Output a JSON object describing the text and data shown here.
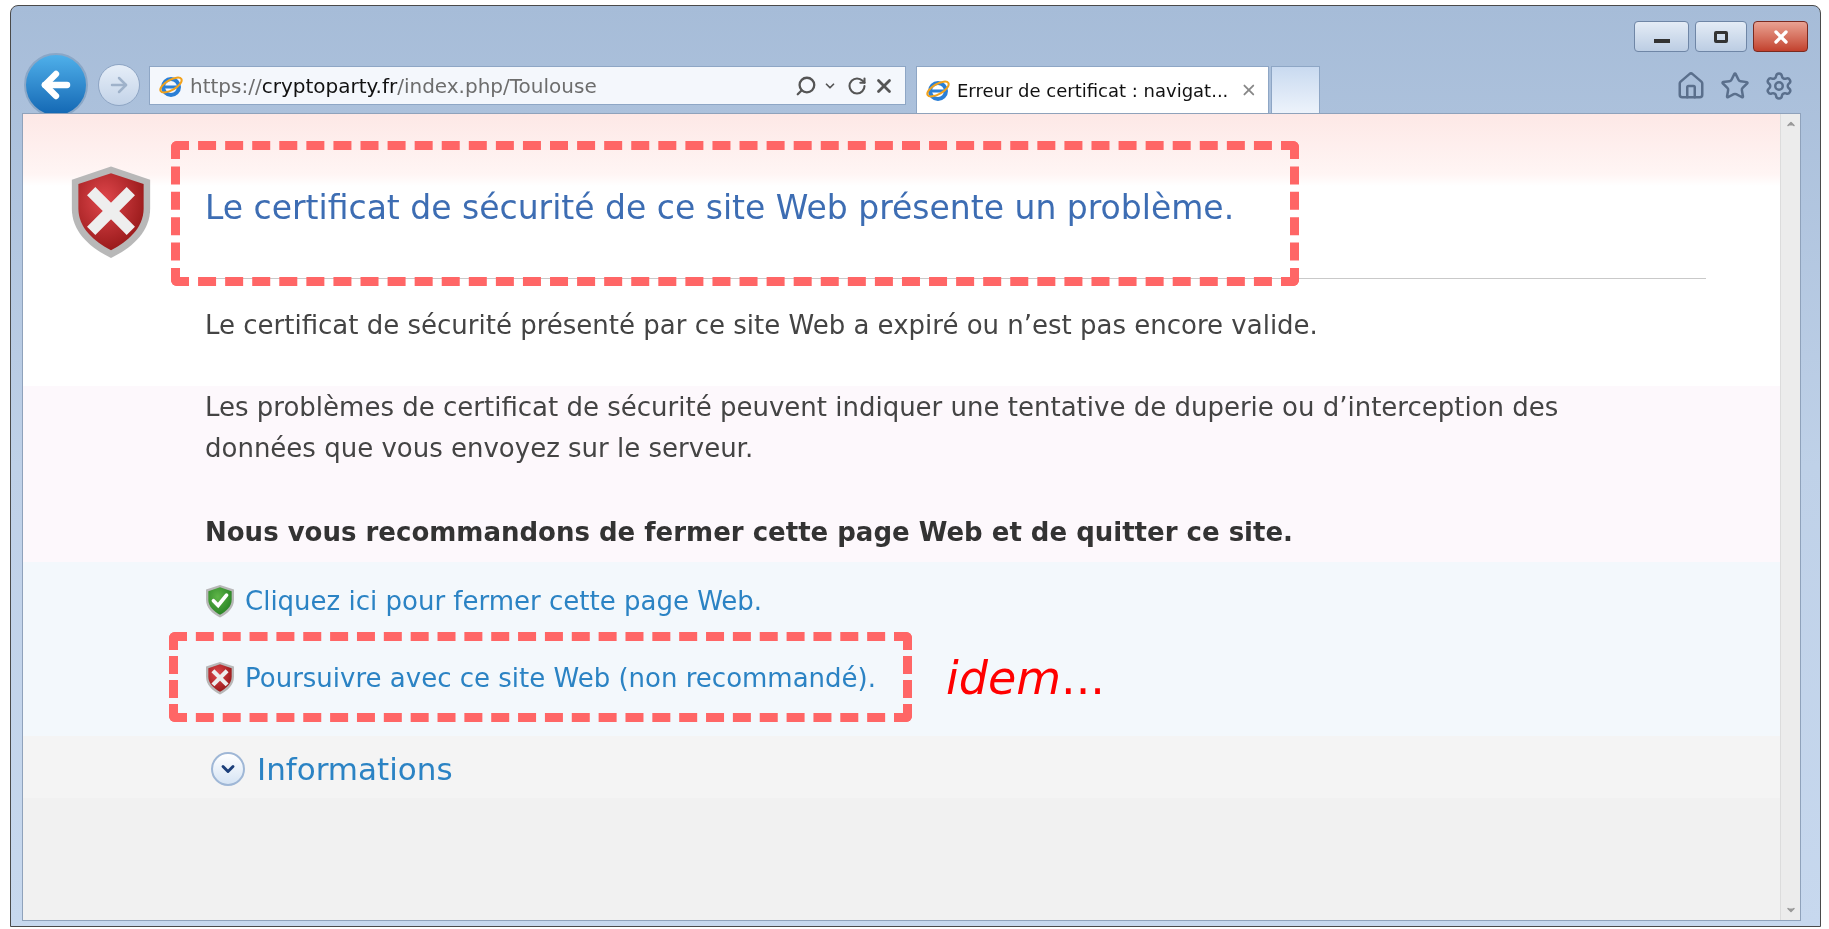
{
  "address_bar": {
    "url_parts": [
      {
        "text": "https://",
        "emphasis": false
      },
      {
        "text": "cryptoparty.fr",
        "emphasis": true
      },
      {
        "text": "/index.php/Toulouse",
        "emphasis": false
      }
    ]
  },
  "tabs": [
    {
      "title": "Erreur de certificat : navigat...",
      "selected": true
    }
  ],
  "page": {
    "heading": {
      "text": "Le certificat de sécurité de ce site Web présente un problème.",
      "highlighted": true
    },
    "message": "Le certificat de sécurité présenté par ce site Web a expiré ou n’est pas encore valide.",
    "details": "Les problèmes de certificat de sécurité peuvent indiquer une tentative de duperie ou d’interception des données que vous envoyez sur le serveur.",
    "recommendation": "Nous vous recommandons de fermer cette page Web et de quitter ce site.",
    "links": [
      {
        "kind": "safe",
        "text": "Cliquez ici pour fermer cette page Web.",
        "highlighted": false
      },
      {
        "kind": "unsafe",
        "text": "Poursuivre avec ce site Web (non recommandé).",
        "highlighted": true,
        "note": "*idem*..."
      }
    ],
    "more_info": {
      "label": "Informations",
      "expanded": false
    }
  }
}
